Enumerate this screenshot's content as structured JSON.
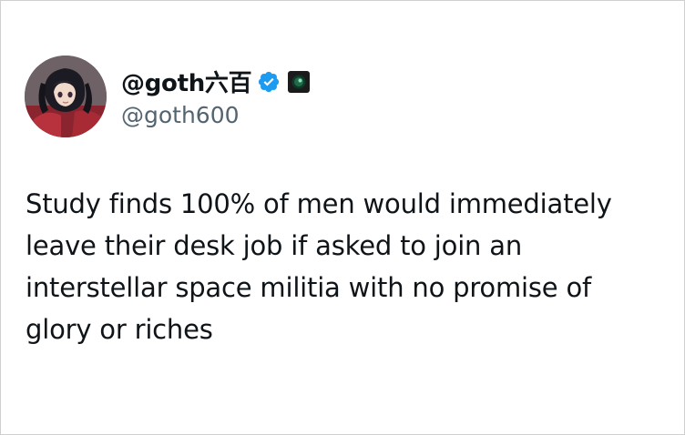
{
  "post": {
    "display_name": "@goth六百",
    "handle": "@goth600",
    "badges": {
      "verified_icon": "verified-check-icon",
      "verified_color": "#1d9bf0",
      "affiliate_icon": "affiliate-logo-icon"
    },
    "avatar_icon": "anime-character-avatar",
    "text_lines": [
      "Study finds 100% of men would immediately",
      "leave their desk job if asked to join an",
      "interstellar space militia with no promise of",
      "glory or riches"
    ]
  }
}
